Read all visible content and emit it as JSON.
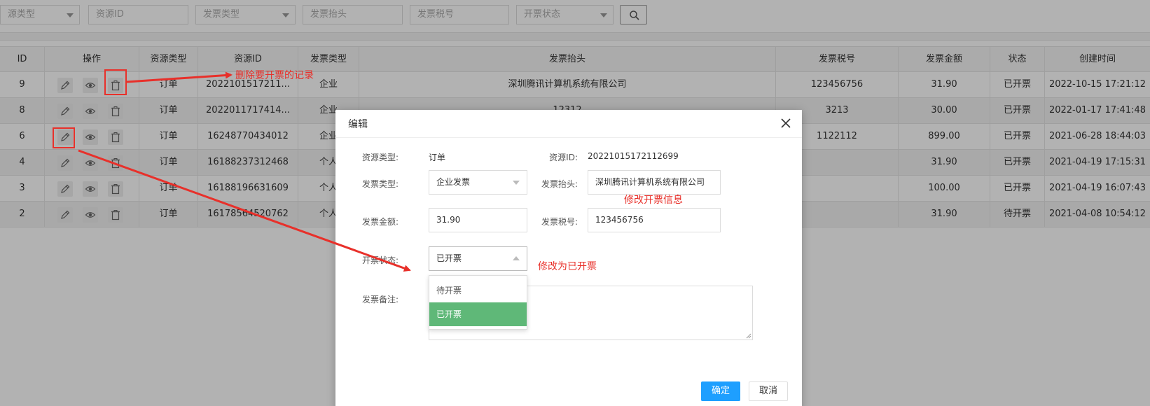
{
  "filters": [
    {
      "placeholder": "源类型",
      "has_caret": true
    },
    {
      "placeholder": "资源ID",
      "has_caret": false
    },
    {
      "placeholder": "发票类型",
      "has_caret": true
    },
    {
      "placeholder": "发票抬头",
      "has_caret": false
    },
    {
      "placeholder": "发票税号",
      "has_caret": false
    },
    {
      "placeholder": "开票状态",
      "has_caret": true
    }
  ],
  "table": {
    "headers": [
      "ID",
      "操作",
      "资源类型",
      "资源ID",
      "发票类型",
      "发票抬头",
      "发票税号",
      "发票金额",
      "状态",
      "创建时间"
    ],
    "rows": [
      {
        "id": "9",
        "type": "订单",
        "rid": "2022101517211...",
        "itype": "企业",
        "title": "深圳腾讯计算机系统有限公司",
        "tax": "123456756",
        "amount": "31.90",
        "status": "已开票",
        "created": "2022-10-15 17:21:12"
      },
      {
        "id": "8",
        "type": "订单",
        "rid": "2022011717414...",
        "itype": "企业",
        "title": "12312",
        "tax": "3213",
        "amount": "30.00",
        "status": "已开票",
        "created": "2022-01-17 17:41:48"
      },
      {
        "id": "6",
        "type": "订单",
        "rid": "16248770434012",
        "itype": "企业",
        "title": "",
        "tax": "1122112",
        "amount": "899.00",
        "status": "已开票",
        "created": "2021-06-28 18:44:03"
      },
      {
        "id": "4",
        "type": "订单",
        "rid": "16188237312468",
        "itype": "个人",
        "title": "",
        "tax": "",
        "amount": "31.90",
        "status": "已开票",
        "created": "2021-04-19 17:15:31"
      },
      {
        "id": "3",
        "type": "订单",
        "rid": "16188196631609",
        "itype": "个人",
        "title": "",
        "tax": "",
        "amount": "100.00",
        "status": "已开票",
        "created": "2021-04-19 16:07:43"
      },
      {
        "id": "2",
        "type": "订单",
        "rid": "16178564520762",
        "itype": "个人",
        "title": "",
        "tax": "",
        "amount": "31.90",
        "status": "待开票",
        "created": "2021-04-08 10:54:12"
      }
    ]
  },
  "modal": {
    "title": "编辑",
    "labels": {
      "resource_type": "资源类型:",
      "resource_id": "资源ID:",
      "invoice_type": "发票类型:",
      "invoice_title": "发票抬头:",
      "invoice_amount": "发票金额:",
      "invoice_tax": "发票税号:",
      "invoice_status": "开票状态:",
      "invoice_note": "发票备注:"
    },
    "values": {
      "resource_type": "订单",
      "resource_id": "20221015172112699",
      "invoice_type": "企业发票",
      "invoice_title": "深圳腾讯计算机系统有限公司",
      "invoice_amount": "31.90",
      "invoice_tax": "123456756",
      "invoice_status": "已开票"
    },
    "status_options": [
      "待开票",
      "已开票"
    ],
    "status_selected_index": 1,
    "ok_label": "确定",
    "cancel_label": "取消"
  },
  "annotations": {
    "delete_note": "删除要开票的记录",
    "edit_note": "修改开票信息",
    "status_note": "修改为已开票",
    "color": "#e8302a"
  },
  "colors": {
    "primary_button": "#1e9fff",
    "selected_option": "#5fb878"
  }
}
